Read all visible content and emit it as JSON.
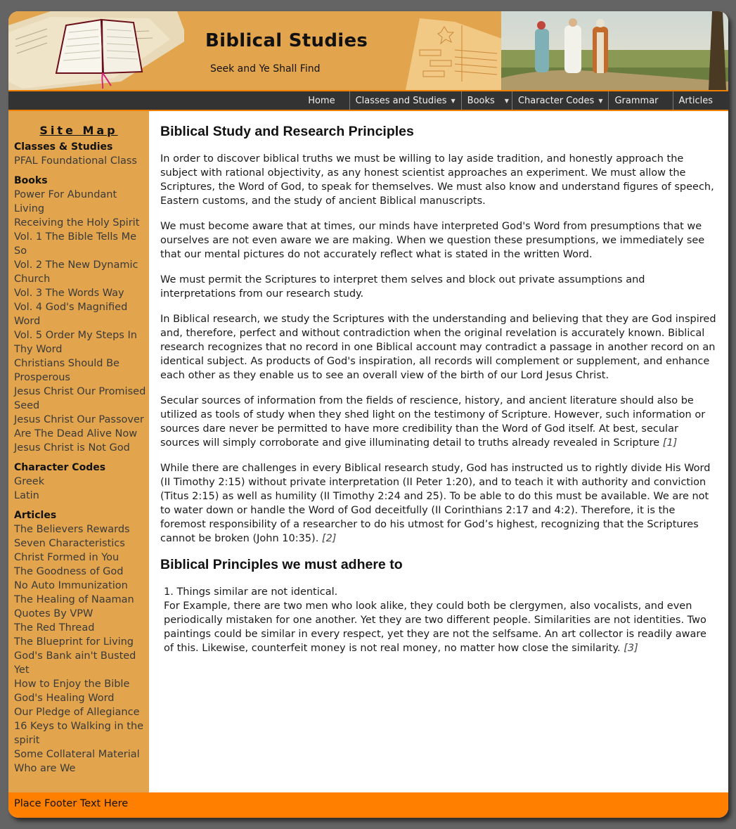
{
  "header": {
    "title": "Biblical Studies",
    "tagline": "Seek and Ye Shall Find"
  },
  "nav": {
    "items": [
      {
        "label": "Home",
        "has_dropdown": false
      },
      {
        "label": "Classes and Studies",
        "has_dropdown": true
      },
      {
        "label": "Books",
        "has_dropdown": true
      },
      {
        "label": "Character Codes",
        "has_dropdown": true
      },
      {
        "label": "Grammar",
        "has_dropdown": false
      },
      {
        "label": "Articles",
        "has_dropdown": false
      }
    ],
    "caret": "▼"
  },
  "sidebar": {
    "title": "Site Map",
    "groups": [
      {
        "heading": "Classes & Studies",
        "links": [
          "PFAL Foundational Class"
        ]
      },
      {
        "heading": "Books",
        "links": [
          "Power For Abundant Living",
          "Receiving the Holy Spirit",
          "Vol. 1 The Bible Tells Me So",
          "Vol. 2 The New Dynamic Church",
          "Vol. 3 The Words Way",
          "Vol. 4 God's Magnified Word",
          "Vol. 5 Order My Steps In Thy Word",
          "Christians Should Be Prosperous",
          "Jesus Christ Our Promised Seed",
          "Jesus Christ Our Passover",
          "Are The Dead Alive Now",
          "Jesus Christ is Not God"
        ]
      },
      {
        "heading": "Character Codes",
        "links": [
          "Greek",
          "Latin"
        ]
      },
      {
        "heading": "Articles",
        "links": [
          "The Believers Rewards",
          "Seven Characteristics",
          "Christ Formed in You",
          "The Goodness of God",
          "No Auto Immunization",
          "The Healing of Naaman",
          "Quotes By VPW",
          "The Red Thread",
          "The Blueprint for Living",
          "God's Bank ain't Busted Yet",
          "How to Enjoy the Bible",
          "God's Healing Word",
          "Our Pledge of Allegiance",
          "16 Keys to Walking in the spirit",
          "Some Collateral Material",
          "Who are We"
        ]
      }
    ]
  },
  "main": {
    "heading": "Biblical Study and Research Principles",
    "paragraphs": [
      {
        "text": "In order to discover biblical truths we must be willing to lay aside tradition, and honestly approach the subject with rational objectivity, as any honest scientist approaches an experiment. We must allow the Scriptures, the Word of God, to speak for themselves. We must also know and understand figures of speech, Eastern customs, and the study of ancient Biblical manuscripts.",
        "ref": ""
      },
      {
        "text": "We must become aware that at times, our minds have interpreted God's Word from presumptions that we ourselves are not even aware we are making. When we question these presumptions, we immediately see that our mental pictures do not accurately reflect what is stated in the written Word.",
        "ref": ""
      },
      {
        "text": "We must permit the Scriptures to interpret them selves and block out private assumptions and interpretations from our research study.",
        "ref": ""
      },
      {
        "text": "In Biblical research, we study the Scriptures with the understanding and believing that they are God inspired and, therefore, perfect and without contradiction when the original revelation is accurately known. Biblical research recognizes that no record in one Biblical account may contradict a passage in another record on an identical subject. As products of God's inspiration, all records will complement or supplement, and enhance each other as they enable us to see an overall view of the birth of our Lord Jesus Christ.",
        "ref": ""
      },
      {
        "text": "Secular sources of information from the fields of rescience, history, and ancient literature should also be utilized as tools of study when they shed light on the testimony of Scripture. However, such information or sources dare never be permitted to have more credibility than the Word of God itself. At best, secular sources will simply corroborate and give illuminating detail to truths already revealed in Scripture ",
        "ref": "[1]"
      },
      {
        "text": "While there are challenges in every Biblical research study, God has instructed us to rightly divide His Word (II Timothy 2:15) without private interpretation (II Peter 1:20), and to teach it with authority and conviction (Titus 2:15) as well as humility (II Timothy 2:24 and 25). To be able to do this must be available. We are not to water down or handle the Word of God deceitfully (II Corinthians 2:17 and 4:2). Therefore, it is the foremost responsibility of a researcher to do his utmost for God’s highest, recognizing that the Scriptures cannot be broken (John 10:35). ",
        "ref": "[2]"
      }
    ],
    "subheading": "Biblical Principles we must adhere to",
    "principles": [
      {
        "title": "1. Things similar are not identical.",
        "text": "For Example, there are two men who look alike, they could both be clergymen, also vocalists, and even periodically mistaken for one another. Yet they are two different people. Similarities are not identities. Two paintings could be similar in every respect, yet they are not the selfsame. An art collector is readily aware of this. Likewise, counterfeit money is not real money, no matter how close the similarity. ",
        "ref": "[3]"
      }
    ]
  },
  "footer": {
    "text": "Place Footer Text Here"
  },
  "colors": {
    "header_bg": "#e2a44c",
    "nav_bg": "#333333",
    "nav_accent": "#f07f00",
    "sidebar_bg": "#e2a44c",
    "footer_bg": "#ff7f00",
    "page_bg": "#646464"
  }
}
